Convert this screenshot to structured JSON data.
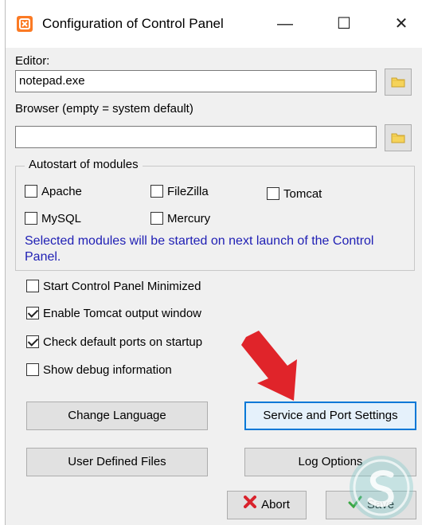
{
  "window": {
    "title": "Configuration of Control Panel",
    "minimize": "—",
    "maximize": "☐",
    "close": "✕"
  },
  "editor": {
    "label": "Editor:",
    "value": "notepad.exe"
  },
  "browser": {
    "label": "Browser (empty = system default)",
    "value": ""
  },
  "autostart": {
    "title": "Autostart of modules",
    "modules": [
      {
        "label": "Apache",
        "checked": false
      },
      {
        "label": "FileZilla",
        "checked": false
      },
      {
        "label": "Tomcat",
        "checked": false
      },
      {
        "label": "MySQL",
        "checked": false
      },
      {
        "label": "Mercury",
        "checked": false
      }
    ],
    "info": "Selected modules will be started on next launch of the Control Panel."
  },
  "options": [
    {
      "label": "Start Control Panel Minimized",
      "checked": false
    },
    {
      "label": "Enable Tomcat output window",
      "checked": true
    },
    {
      "label": "Check default ports on startup",
      "checked": true
    },
    {
      "label": "Show debug information",
      "checked": false
    }
  ],
  "buttons": {
    "change_language": "Change Language",
    "service_port": "Service and Port Settings",
    "user_files": "User Defined Files",
    "log_options": "Log Options",
    "abort": "Abort",
    "save": "Save"
  },
  "colors": {
    "accent": "#0078d7",
    "info_text": "#1e1eb4",
    "arrow": "#e0242a",
    "app_icon": "#fb7a24"
  },
  "icons": {
    "app": "xampp-icon",
    "folder": "folder-icon",
    "abort": "x-mark-icon",
    "save": "checkmark-icon",
    "pointer": "red-arrow-icon"
  }
}
